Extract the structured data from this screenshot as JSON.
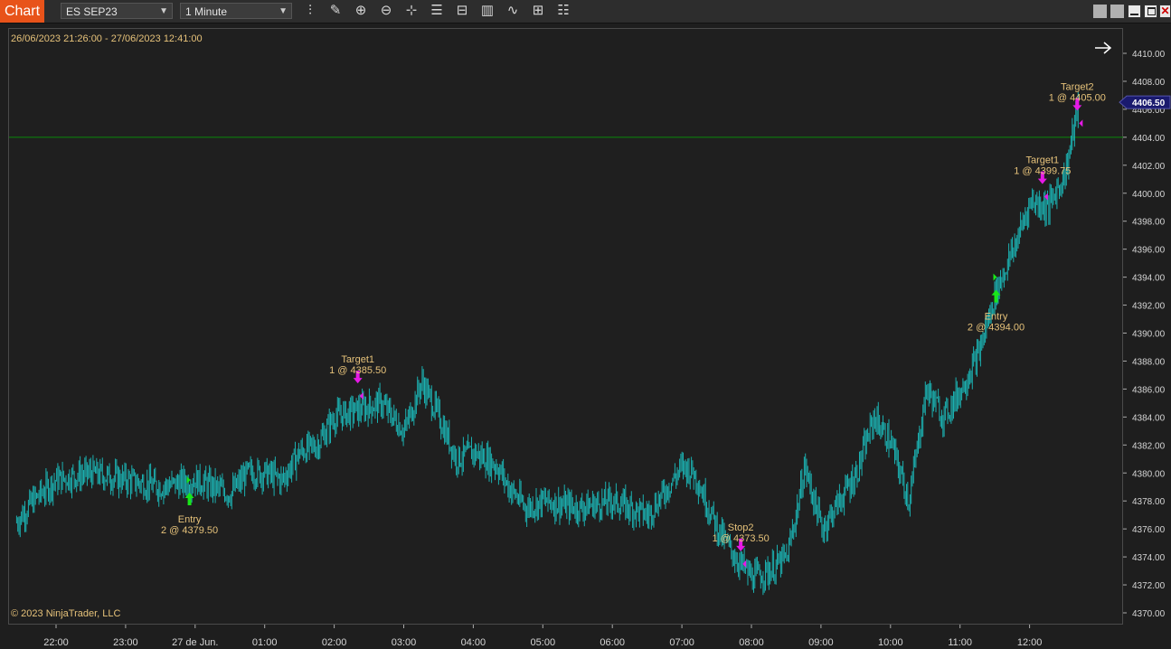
{
  "toolbar": {
    "tab_label": "Chart",
    "instrument": "ES SEP23",
    "interval": "1 Minute",
    "icons": [
      "bar-type-icon",
      "draw-pencil-icon",
      "zoom-in-icon",
      "zoom-out-icon",
      "crosshair-icon",
      "properties-icon",
      "templates-icon",
      "data-series-icon",
      "indicators-icon",
      "strategies-icon",
      "chart-trader-icon"
    ],
    "window_buttons": [
      "minimize-icon",
      "restore-icon",
      "maximize-icon",
      "close-icon"
    ]
  },
  "chart": {
    "date_range": "26/06/2023 21:26:00 - 27/06/2023 12:41:00",
    "copyright": "© 2023 NinjaTrader, LLC",
    "last_price": "4406.50",
    "colors": {
      "bars": "#1bb0b0",
      "buy": "#19e619",
      "sell": "#e619e6",
      "line": "#0a8a0a",
      "label": "#e6c27a"
    }
  },
  "chart_data": {
    "type": "bar",
    "title": "",
    "y_ticks": [
      "4410.00",
      "4408.00",
      "4406.00",
      "4404.00",
      "4402.00",
      "4400.00",
      "4398.00",
      "4396.00",
      "4394.00",
      "4392.00",
      "4390.00",
      "4388.00",
      "4386.00",
      "4384.00",
      "4382.00",
      "4380.00",
      "4378.00",
      "4376.00",
      "4374.00",
      "4372.00",
      "4370.00"
    ],
    "x_ticks": [
      "22:00",
      "23:00",
      "27 de Jun.",
      "01:00",
      "02:00",
      "03:00",
      "04:00",
      "05:00",
      "06:00",
      "07:00",
      "08:00",
      "09:00",
      "10:00",
      "11:00",
      "12:00"
    ],
    "ylim": [
      4369.5,
      4412
    ],
    "horizontal_line": 4404.0,
    "price_path": [
      [
        "21:26",
        4376.5
      ],
      [
        "21:40",
        4378
      ],
      [
        "22:00",
        4379.5
      ],
      [
        "22:30",
        4380
      ],
      [
        "23:00",
        4379.5
      ],
      [
        "23:30",
        4379
      ],
      [
        "24:00",
        4379.5
      ],
      [
        "00:30",
        4378.5
      ],
      [
        "00:45",
        4380
      ],
      [
        "01:00",
        4380
      ],
      [
        "01:15",
        4379.5
      ],
      [
        "01:30",
        4381.5
      ],
      [
        "01:45",
        4382
      ],
      [
        "02:00",
        4384
      ],
      [
        "02:20",
        4384.5
      ],
      [
        "02:40",
        4385
      ],
      [
        "03:00",
        4383
      ],
      [
        "03:15",
        4386.5
      ],
      [
        "03:30",
        4384
      ],
      [
        "03:45",
        4381
      ],
      [
        "04:00",
        4381.5
      ],
      [
        "04:20",
        4380.5
      ],
      [
        "04:30",
        4379
      ],
      [
        "04:45",
        4377.5
      ],
      [
        "05:00",
        4378
      ],
      [
        "05:30",
        4377.5
      ],
      [
        "06:00",
        4378
      ],
      [
        "06:30",
        4377
      ],
      [
        "07:00",
        4380.5
      ],
      [
        "07:10",
        4380
      ],
      [
        "07:30",
        4376
      ],
      [
        "07:45",
        4374
      ],
      [
        "08:00",
        4372.5
      ],
      [
        "08:15",
        4373
      ],
      [
        "08:30",
        4374
      ],
      [
        "08:40",
        4378
      ],
      [
        "08:45",
        4380.5
      ],
      [
        "09:00",
        4376
      ],
      [
        "09:15",
        4378
      ],
      [
        "09:30",
        4380
      ],
      [
        "09:45",
        4384
      ],
      [
        "10:00",
        4382
      ],
      [
        "10:15",
        4378
      ],
      [
        "10:30",
        4386
      ],
      [
        "10:45",
        4384
      ],
      [
        "11:00",
        4386
      ],
      [
        "11:15",
        4388.5
      ],
      [
        "11:30",
        4393
      ],
      [
        "11:45",
        4396
      ],
      [
        "12:00",
        4399.5
      ],
      [
        "12:15",
        4399
      ],
      [
        "12:30",
        4401.5
      ],
      [
        "12:41",
        4406.5
      ]
    ],
    "executions": [
      {
        "time": "23:55",
        "price": 4379.5,
        "side": "buy",
        "name": "Entry",
        "text": "2 @ 4379.50"
      },
      {
        "time": "02:20",
        "price": 4385.5,
        "side": "sell",
        "name": "Target1",
        "text": "1 @ 4385.50"
      },
      {
        "time": "07:50",
        "price": 4373.5,
        "side": "sell",
        "name": "Stop2",
        "text": "1 @ 4373.50"
      },
      {
        "time": "11:30",
        "price": 4394.0,
        "side": "buy",
        "name": "Entry",
        "text": "2 @ 4394.00"
      },
      {
        "time": "12:10",
        "price": 4399.75,
        "side": "sell",
        "name": "Target1",
        "text": "1 @ 4399.75"
      },
      {
        "time": "12:40",
        "price": 4405.0,
        "side": "sell",
        "name": "Target2",
        "text": "1 @ 4405.00"
      }
    ]
  }
}
